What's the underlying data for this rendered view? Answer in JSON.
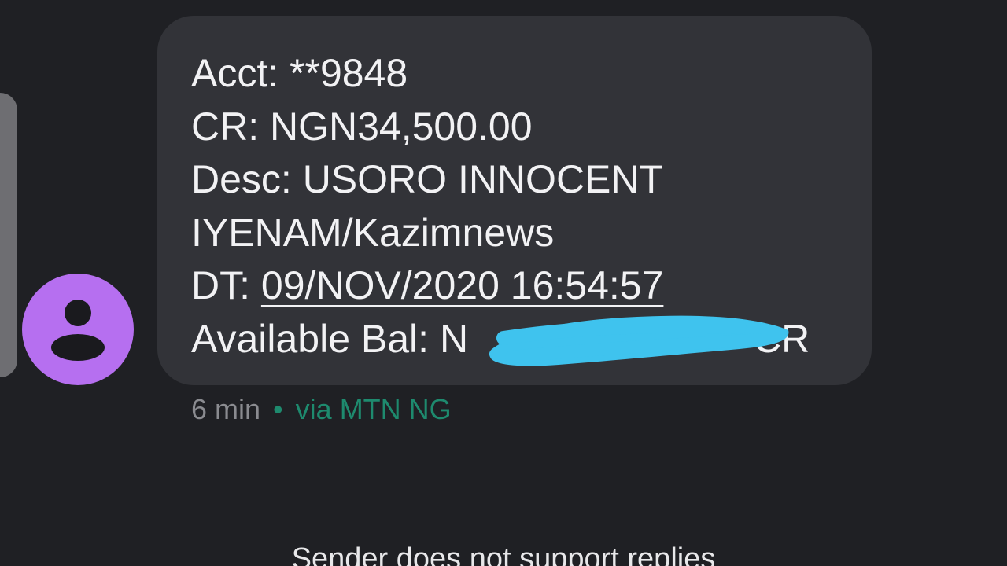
{
  "message": {
    "lines": [
      "Acct: **9848",
      "CR: NGN34,500.00",
      "Desc: USORO INNOCENT",
      "IYENAM/Kazimnews"
    ],
    "date_label": "DT: ",
    "date_value": "09/NOV/2020 16:54:57",
    "balance_prefix": "Available Bal: N",
    "balance_suffix": "CR"
  },
  "meta": {
    "time": "6 min",
    "separator": "•",
    "via": "via MTN NG"
  },
  "footer": {
    "note": "Sender does not support replies"
  },
  "colors": {
    "background": "#1f2024",
    "bubble": "#323338",
    "avatar": "#b66ff0",
    "accent": "#1e8a6e",
    "redaction": "#3fc3ee"
  },
  "icons": {
    "avatar": "person-icon"
  }
}
